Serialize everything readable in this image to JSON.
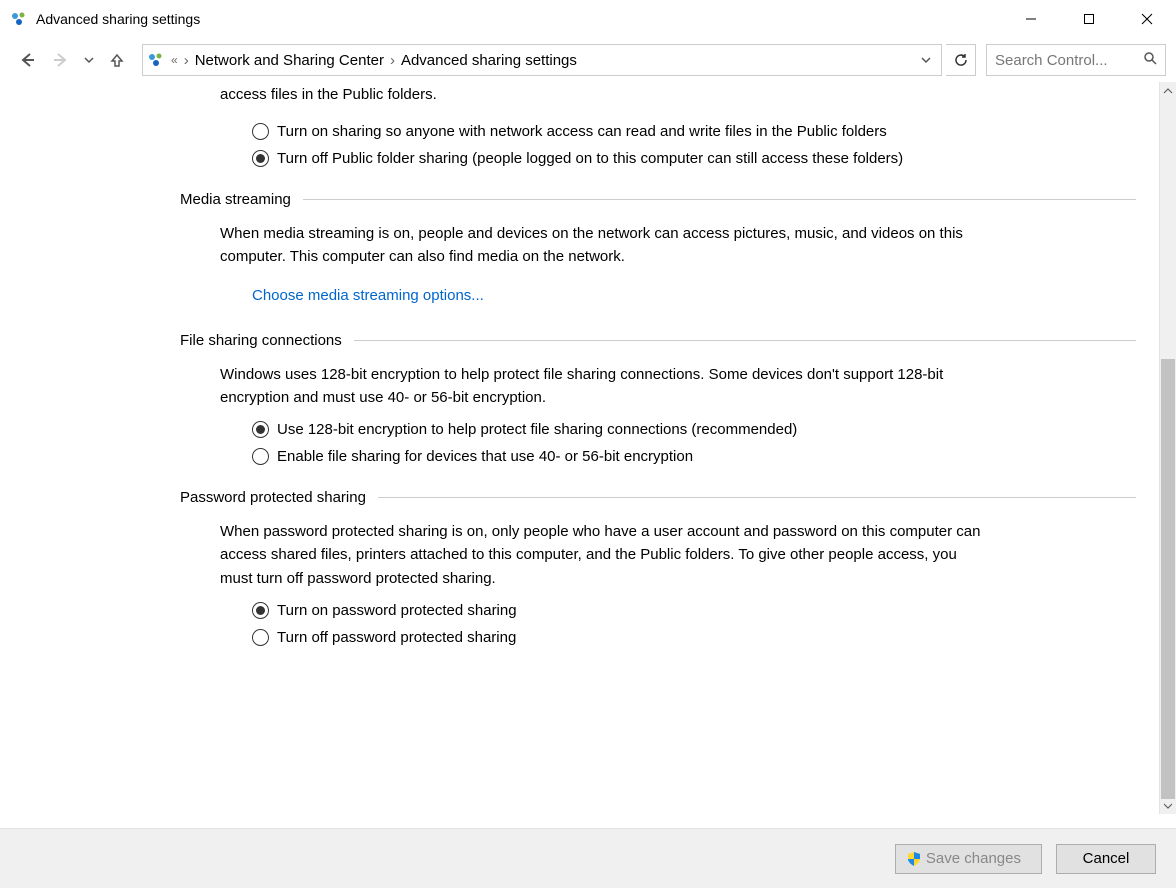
{
  "window": {
    "title": "Advanced sharing settings"
  },
  "breadcrumb": {
    "parent": "Network and Sharing Center",
    "current": "Advanced sharing settings"
  },
  "search": {
    "placeholder": "Search Control..."
  },
  "public_folder": {
    "partial_line": "access files in the Public folders.",
    "option_on": "Turn on sharing so anyone with network access can read and write files in the Public folders",
    "option_off": "Turn off Public folder sharing (people logged on to this computer can still access these folders)",
    "selected": "off"
  },
  "media_streaming": {
    "title": "Media streaming",
    "desc": "When media streaming is on, people and devices on the network can access pictures, music, and videos on this computer. This computer can also find media on the network.",
    "link": "Choose media streaming options..."
  },
  "file_sharing": {
    "title": "File sharing connections",
    "desc": "Windows uses 128-bit encryption to help protect file sharing connections. Some devices don't support 128-bit encryption and must use 40- or 56-bit encryption.",
    "option_128": "Use 128-bit encryption to help protect file sharing connections (recommended)",
    "option_40": "Enable file sharing for devices that use 40- or 56-bit encryption",
    "selected": "128"
  },
  "password_sharing": {
    "title": "Password protected sharing",
    "desc": "When password protected sharing is on, only people who have a user account and password on this computer can access shared files, printers attached to this computer, and the Public folders. To give other people access, you must turn off password protected sharing.",
    "option_on": "Turn on password protected sharing",
    "option_off": "Turn off password protected sharing",
    "selected": "on"
  },
  "footer": {
    "save": "Save changes",
    "cancel": "Cancel"
  }
}
